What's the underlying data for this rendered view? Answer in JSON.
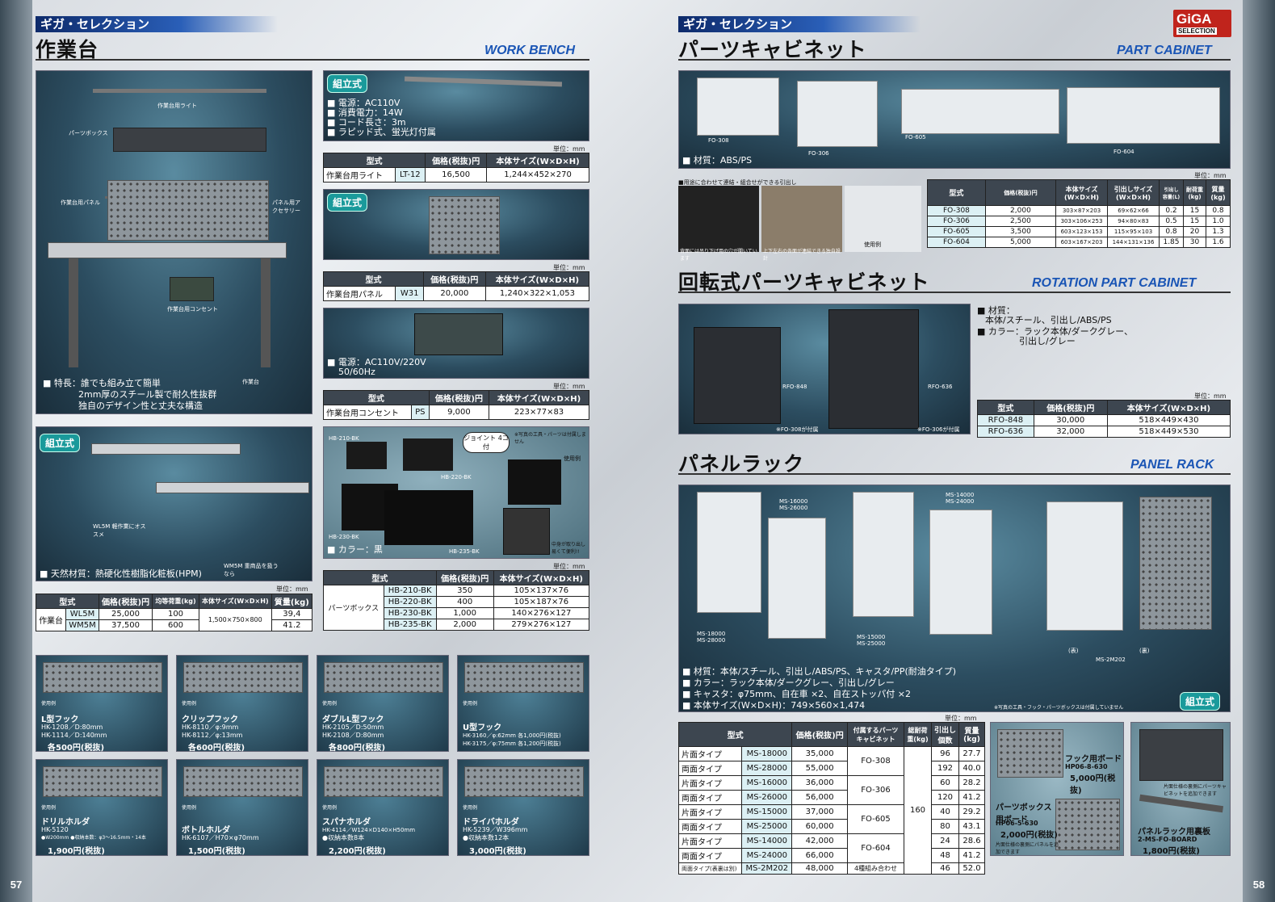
{
  "left": {
    "series": "ギガ・セレクション",
    "title": "作業台",
    "subtitle": "WORK BENCH",
    "page_no": "57",
    "main_photo": {
      "labels": [
        "作業台用ライト",
        "パーツボックス",
        "作業台用パネル",
        "パネル用アクセサリー",
        "作業台用コンセント",
        "作業台"
      ],
      "features": [
        "■ 特長：誰でも組み立て簡単",
        "2mm厚のスチール製で耐久性抜群",
        "独自のデザイン性と丈夫な構造"
      ]
    },
    "light": {
      "tag": "組立式",
      "specs": [
        "■ 電源：AC110V",
        "■ 消費電力：14W",
        "■ コード長さ：3m",
        "■ ラピッド式、蛍光灯付属"
      ],
      "unit": "単位：mm",
      "headers": [
        "型式",
        "価格(税抜)円",
        "本体サイズ(W×D×H)"
      ],
      "row": [
        "作業台用ライト",
        "LT-12",
        "16,500",
        "1,244×452×270"
      ]
    },
    "panel": {
      "tag": "組立式",
      "unit": "単位：mm",
      "headers": [
        "型式",
        "価格(税抜)円",
        "本体サイズ(W×D×H)"
      ],
      "row": [
        "作業台用パネル",
        "W31",
        "20,000",
        "1,240×322×1,053"
      ]
    },
    "outlet": {
      "specs": [
        "■ 電源：AC110V/220V",
        "50/60Hz"
      ],
      "unit": "単位：mm",
      "headers": [
        "型式",
        "価格(税抜)円",
        "本体サイズ(W×D×H)"
      ],
      "row": [
        "作業台用コンセント",
        "PS",
        "9,000",
        "223×77×83"
      ]
    },
    "bench": {
      "tag": "組立式",
      "label_wl": "WL5M 軽作業にオススメ",
      "label_wm": "WM5M 重商品を扱うなら",
      "material": "■ 天然材質：熱硬化性樹脂化粧板(HPM)",
      "unit": "単位：mm",
      "headers": [
        "型式",
        "価格(税抜)円",
        "均等荷重(kg)",
        "本体サイズ(W×D×H)",
        "質量(kg)"
      ],
      "group": "作業台",
      "rows": [
        [
          "WL5M",
          "25,000",
          "100",
          "39,4"
        ],
        [
          "WM5M",
          "37,500",
          "600",
          "41.2"
        ]
      ],
      "size": "1,500×750×800"
    },
    "boxes": {
      "joint": "ジョイント 4コ付",
      "note": "※写真の工具・パーツは付属しません",
      "usage": "使用例",
      "side_note": "中身が取り出し易くて便利!!",
      "labels": [
        "HB-210-BK",
        "HB-220-BK",
        "HB-230-BK",
        "HB-235-BK"
      ],
      "color": "■ カラー：黒",
      "unit": "単位：mm",
      "headers": [
        "型式",
        "価格(税抜)円",
        "本体サイズ(W×D×H)"
      ],
      "group": "パーツボックス",
      "rows": [
        [
          "HB-210-BK",
          "350",
          "105×137×76"
        ],
        [
          "HB-220-BK",
          "400",
          "105×187×76"
        ],
        [
          "HB-230-BK",
          "1,000",
          "140×276×127"
        ],
        [
          "HB-235-BK",
          "2,000",
          "279×276×127"
        ]
      ]
    },
    "accessories": [
      {
        "usage": "使用例",
        "name": "L型フック",
        "desc": [
          "HK-1208／D:80mm",
          "HK-1114／D:140mm"
        ],
        "price": "各500円(税抜)"
      },
      {
        "usage": "使用例",
        "name": "クリップフック",
        "desc": [
          "HK-8110／φ:9mm",
          "HK-8112／φ:13mm"
        ],
        "price": "各600円(税抜)"
      },
      {
        "usage": "使用例",
        "name": "ダブルL型フック",
        "desc": [
          "HK-2105／D:50mm",
          "HK-2108／D:80mm"
        ],
        "price": "各800円(税抜)"
      },
      {
        "usage": "使用例",
        "name": "U型フック",
        "desc": [
          "HK-3160／φ:62mm 各1,000円(税抜)",
          "HK-3175／φ:75mm 各1,200円(税抜)"
        ],
        "price": ""
      },
      {
        "usage": "使用例",
        "name": "ドリルホルダ",
        "desc": [
          "HK-5120",
          "●W200mm ●収納本数：φ3～16.5mm・14本"
        ],
        "price": "1,900円(税抜)"
      },
      {
        "usage": "使用例",
        "name": "ボトルホルダ",
        "desc": [
          "HK-6107／H70×φ70mm"
        ],
        "price": "1,500円(税抜)"
      },
      {
        "usage": "使用例",
        "name": "スパナホルダ",
        "desc": [
          "HK-4114／W124×D140×H50mm",
          "●収納本数8本"
        ],
        "price": "2,200円(税抜)"
      },
      {
        "usage": "使用例",
        "name": "ドライバホルダ",
        "desc": [
          "HK-5239／W396mm",
          "●収納本数12本"
        ],
        "price": "3,000円(税抜)"
      }
    ]
  },
  "right": {
    "series": "ギガ・セレクション",
    "page_no": "58",
    "logo": {
      "top": "GiGA",
      "bottom": "SELECTION"
    },
    "cabinet": {
      "title": "パーツキャビネット",
      "subtitle": "PART CABINET",
      "labels": [
        "FO-308",
        "FO-306",
        "FO-605",
        "FO-604"
      ],
      "material": "■ 材質：ABS/PS",
      "note_top": "■用途に合わせて連結・組合せができる引出し",
      "note_a": "背面には吊り下げ用の穴が開いています",
      "note_b": "上下左右の各面が連結できる独自設計",
      "usage": "使用例",
      "unit": "単位：mm",
      "headers": [
        "型式",
        "価格(税抜)円",
        "本体サイズ(W×D×H)",
        "引出しサイズ(W×D×H)",
        "引出し容量(L)",
        "耐荷重(kg)",
        "質量(kg)"
      ],
      "rows": [
        [
          "FO-308",
          "2,000",
          "303×87×203",
          "69×62×66",
          "0.2",
          "15",
          "0.8"
        ],
        [
          "FO-306",
          "2,500",
          "303×106×253",
          "94×80×83",
          "0.5",
          "15",
          "1.0"
        ],
        [
          "FO-605",
          "3,500",
          "603×123×153",
          "115×95×103",
          "0.8",
          "20",
          "1.3"
        ],
        [
          "FO-604",
          "5,000",
          "603×167×203",
          "144×131×136",
          "1.85",
          "30",
          "1.6"
        ]
      ]
    },
    "rotation": {
      "title": "回転式パーツキャビネット",
      "subtitle": "ROTATION PART CABINET",
      "labels": [
        "RFO-848",
        "RFO-636"
      ],
      "notes": [
        "※FO-308が付属",
        "※FO-306が付属"
      ],
      "specs": [
        "■ 材質：",
        "本体/スチール、引出し/ABS/PS",
        "■ カラー：ラック本体/ダークグレー、",
        "引出し/グレー"
      ],
      "unit": "単位：mm",
      "headers": [
        "型式",
        "価格(税抜)円",
        "本体サイズ(W×D×H)"
      ],
      "rows": [
        [
          "RFO-848",
          "30,000",
          "518×449×430"
        ],
        [
          "RFO-636",
          "32,000",
          "518×449×530"
        ]
      ]
    },
    "rack": {
      "title": "パネルラック",
      "subtitle": "PANEL RACK",
      "labels": [
        "MS-16000",
        "MS-26000",
        "MS-14000",
        "MS-24000",
        "MS-18000",
        "MS-28000",
        "MS-15000",
        "MS-25000",
        "(表)",
        "(裏)",
        "MS-2M202"
      ],
      "specs": [
        "■ 材質：本体/スチール、引出し/ABS/PS、キャスタ/PP(耐油タイプ)",
        "■ カラー：ラック本体/ダークグレー、引出し/グレー",
        "■ キャスタ：φ75mm、自在車 ×2、自在ストッパ付 ×2",
        "■ 本体サイズ(W×D×H)：749×560×1,474"
      ],
      "tag": "組立式",
      "note": "※写真の工具・フック・パーツボックスは付属していません",
      "unit": "単位：mm",
      "headers": [
        "型式",
        "価格(税抜)円",
        "付属するパーツキャビネット",
        "総耐荷重(kg)",
        "引出し個数",
        "質量(kg)"
      ],
      "rows": [
        [
          "片面タイプ",
          "MS-18000",
          "35,000",
          "96",
          "27.7"
        ],
        [
          "両面タイプ",
          "MS-28000",
          "55,000",
          "192",
          "40.0"
        ],
        [
          "片面タイプ",
          "MS-16000",
          "36,000",
          "60",
          "28.2"
        ],
        [
          "両面タイプ",
          "MS-26000",
          "56,000",
          "120",
          "41.2"
        ],
        [
          "片面タイプ",
          "MS-15000",
          "37,000",
          "40",
          "29.2"
        ],
        [
          "両面タイプ",
          "MS-25000",
          "60,000",
          "80",
          "43.1"
        ],
        [
          "片面タイプ",
          "MS-14000",
          "42,000",
          "24",
          "28.6"
        ],
        [
          "両面タイプ",
          "MS-24000",
          "66,000",
          "48",
          "41.2"
        ],
        [
          "両面タイプ(表裏は別)",
          "MS-2M202",
          "48,000",
          "46",
          "52.0"
        ]
      ],
      "cabinets": [
        "FO-308",
        "FO-306",
        "FO-605",
        "FO-604",
        "4種組み合わせ"
      ],
      "load": "160"
    },
    "boards": [
      {
        "name": "フック用ボード",
        "code": "HP06-8-630",
        "price": "5,000円(税抜)"
      },
      {
        "name": "パーツボックス用ボード",
        "code": "HP06-5-630",
        "price": "2,000円(税抜)",
        "note": "片面仕様の裏側にパネルを追加できます"
      },
      {
        "name": "パネルラック用裏板",
        "code": "2-MS-FO-BOARD",
        "price": "1,800円(税抜)",
        "note": "片面仕様の裏側にパーツキャビネットを追加できます"
      }
    ]
  }
}
